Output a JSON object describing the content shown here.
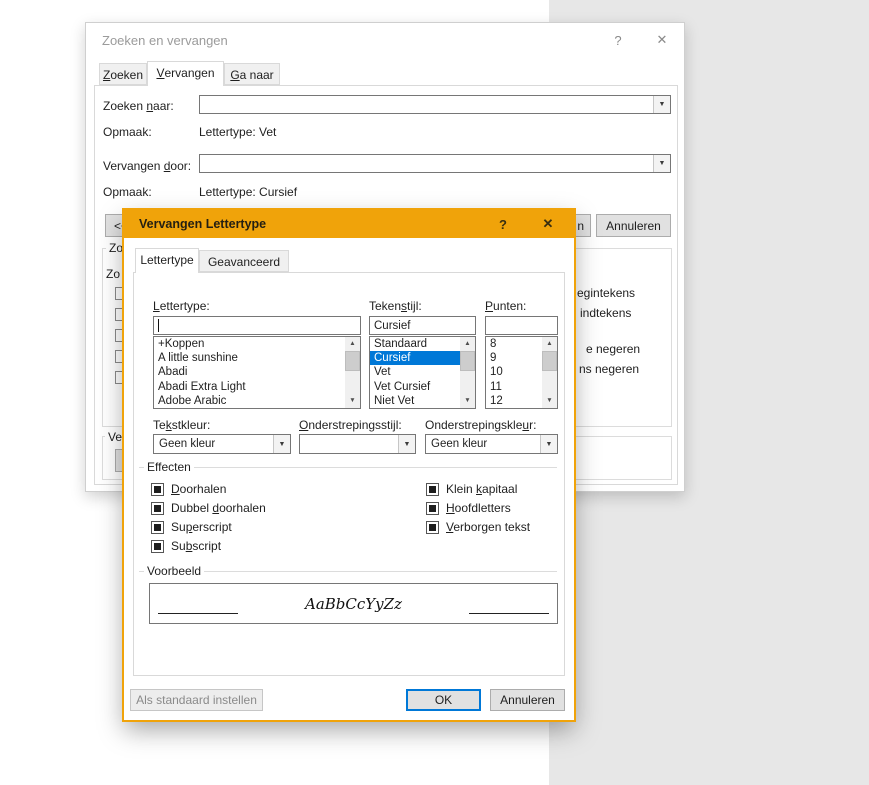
{
  "colors": {
    "highlight_titlebar": "#f0a30a",
    "selection": "#0078d7",
    "default_button_border": "#0078d7",
    "app_background": "#e7e7e7"
  },
  "icons": {
    "help": "?",
    "close": "✕",
    "dropdown": "▼",
    "scroll_up": "▲",
    "scroll_down": "▼"
  },
  "find_dialog": {
    "title": "Zoeken en vervangen",
    "tabs": {
      "zoeken": "~Zoeken",
      "vervangen": "~Vervangen",
      "ga_naar": "~Ga naar"
    },
    "find_label": "Zoeken ~naar:",
    "find_value": "",
    "format_label_1": "Opmaak:",
    "format_value_1": "Lettertype: Vet",
    "replace_label": "Vervangen ~door:",
    "replace_value": "",
    "format_label_2": "Opmaak:",
    "format_value_2": "Lettertype: Cursief",
    "less_button_fragment": "<<",
    "find_next_button_fragment": "n",
    "cancel_button": "Annuleren",
    "options_group_fragment": "Zoe",
    "direction_label_fragment": "Zo",
    "option_fragments": [
      "egintekens",
      "indtekens",
      "e negeren",
      "ns negeren"
    ],
    "replace_group_fragment": "Verv"
  },
  "font_dialog": {
    "title": "Vervangen Lettertype",
    "tabs": {
      "lettertype": "Lettertype",
      "geavanceerd": "Geavanceerd"
    },
    "font_label": "~Lettertype:",
    "font_value": "",
    "font_items": [
      "+Koppen",
      "A little sunshine",
      "Abadi",
      "Abadi Extra Light",
      "Adobe Arabic"
    ],
    "style_label": "Teken~stijl:",
    "style_value": "Cursief",
    "style_items": [
      "Standaard",
      "Cursief",
      "Vet",
      "Vet Cursief",
      "Niet Vet"
    ],
    "style_selected": "Cursief",
    "size_label": "~Punten:",
    "size_value": "",
    "size_items": [
      "8",
      "9",
      "10",
      "11",
      "12"
    ],
    "color_label": "Te~kstkleur:",
    "color_value": "Geen kleur",
    "underline_style_label": "~Onderstrepingsstijl:",
    "underline_style_value": "",
    "underline_color_label": "Onderstrepingskle~ur:",
    "underline_color_value": "Geen kleur",
    "effects_group_label": "Effecten",
    "effects_left": [
      "~Doorhalen",
      "Dubbel ~doorhalen",
      "Su~perscript",
      "Su~bscript"
    ],
    "effects_right": [
      "Klein ~kapitaal",
      "~Hoofdletters",
      "~Verborgen tekst"
    ],
    "preview_group_label": "Voorbeeld",
    "preview_text": "AaBbCcYyZz",
    "default_button": "Als standaard instellen",
    "ok_button": "OK",
    "cancel_button": "Annuleren"
  }
}
